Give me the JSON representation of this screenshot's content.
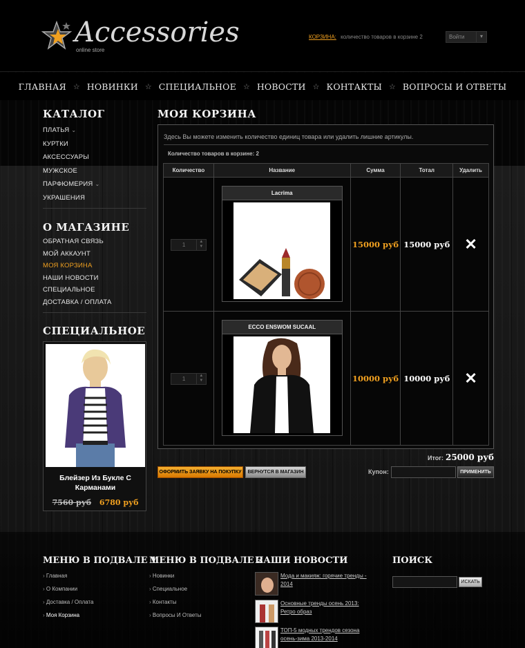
{
  "header": {
    "logo_text": "Accessories",
    "logo_sub": "online store",
    "cart_link": "КОРЗИНА:",
    "cart_summary": "количество товаров в корзине 2",
    "login_label": "Войти"
  },
  "nav": {
    "items": [
      "ГЛАВНАЯ",
      "НОВИНКИ",
      "СПЕЦИАЛЬНОЕ",
      "НОВОСТИ",
      "КОНТАКТЫ",
      "ВОПРОСЫ И ОТВЕТЫ"
    ]
  },
  "sidebar": {
    "catalog_title": "КАТАЛОГ",
    "catalog": [
      "ПЛАТЬЯ",
      "КУРТКИ",
      "АКСЕССУАРЫ",
      "МУЖСКОЕ",
      "ПАРФЮМЕРИЯ",
      "УКРАШЕНИЯ"
    ],
    "about_title": "О МАГАЗИНЕ",
    "about": [
      "ОБРАТНАЯ СВЯЗЬ",
      "МОЙ АККАУНТ",
      "МОЯ КОРЗИНА",
      "НАШИ НОВОСТИ",
      "СПЕЦИАЛЬНОЕ",
      "ДОСТАВКА / ОПЛАТА"
    ],
    "special_title": "СПЕЦИАЛЬНОЕ",
    "special_name": "Блейзер Из Букле С Карманами",
    "special_old_price": "7560 руб",
    "special_new_price": "6780 руб"
  },
  "main": {
    "title": "МОЯ КОРЗИНА",
    "intro": "Здесь Вы можете изменить количество единиц товара или удалить лишние артикулы.",
    "count": "Количество товаров в корзине: 2",
    "columns": [
      "Количество",
      "Название",
      "Сумма",
      "Тотал",
      "Удалить"
    ],
    "rows": [
      {
        "qty": "1",
        "name": "Lacrima",
        "sum": "15000 руб",
        "total": "15000 руб",
        "delete": "✕"
      },
      {
        "qty": "1",
        "name": "ECCO ENSWOM SUCAAL",
        "sum": "10000 руб",
        "total": "10000 руб",
        "delete": "✕"
      }
    ],
    "total_label": "Итог:",
    "total_value": "25000 руб",
    "order_button": "ОФОРМИТЬ ЗАЯВКУ НА ПОКУПКУ",
    "back_button": "ВЕРНУТСЯ В МАГАЗИН",
    "coupon_label": "Купон:",
    "apply_button": "ПРИМЕНИТЬ"
  },
  "footer": {
    "menu1_title": "МЕНЮ В ПОДВАЛЕ 1",
    "menu1": [
      "Главная",
      "О Компании",
      "Доставка / Оплата",
      "Моя Корзина"
    ],
    "menu2_title": "МЕНЮ В ПОДВАЛЕ 2",
    "menu2": [
      "Новинки",
      "Специальное",
      "Контакты",
      "Вопросы И Ответы"
    ],
    "news_title": "НАШИ НОВОСТИ",
    "news": [
      "Мода и макияж: горячие тренды - 2014",
      "Основные тренды осень 2013: Ретро образ",
      "ТОП-5 модных трендов сезона осень-зима 2013-2014"
    ],
    "search_title": "ПОИСК",
    "search_button": "ИСКАТЬ"
  },
  "colors": {
    "accent": "#f0a020",
    "background": "#0d0d0d"
  }
}
